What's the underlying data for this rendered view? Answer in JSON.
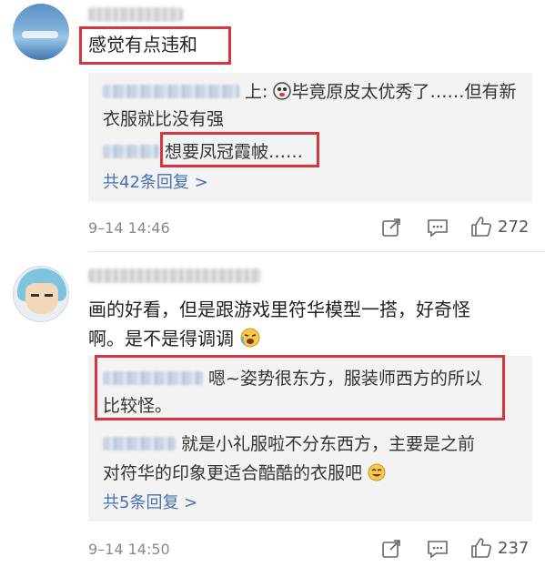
{
  "comments": [
    {
      "text": "感觉有点违和",
      "replies": [
        {
          "prefix": "上:",
          "text": "毕竟原皮太优秀了……但有新",
          "text2": "衣服就比没有强"
        },
        {
          "text": "想要凤冠霞帔……"
        }
      ],
      "more_label": "共42条回复 >",
      "time": "9–14 14:46",
      "like_count": "272"
    },
    {
      "text_line1": "画的好看，但是跟游戏里符华模型一搭，好奇怪",
      "text_line2": "啊。是不是得调调",
      "replies": [
        {
          "text": "嗯~姿势很东方，服装师西方的所以",
          "text2": "比较怪。"
        },
        {
          "text": "就是小礼服啦不分东西方，主要是之前",
          "text2": "对符华的印象更适合酷酷的衣服吧"
        }
      ],
      "more_label": "共5条回复 >",
      "time": "9–14 14:50",
      "like_count": "237"
    }
  ],
  "colors": {
    "highlight": "#d8363c",
    "link": "#4a6fb0",
    "panel": "#f3f3f3"
  },
  "icons": [
    "share-icon",
    "comment-icon",
    "like-icon",
    "emoji-icon"
  ]
}
